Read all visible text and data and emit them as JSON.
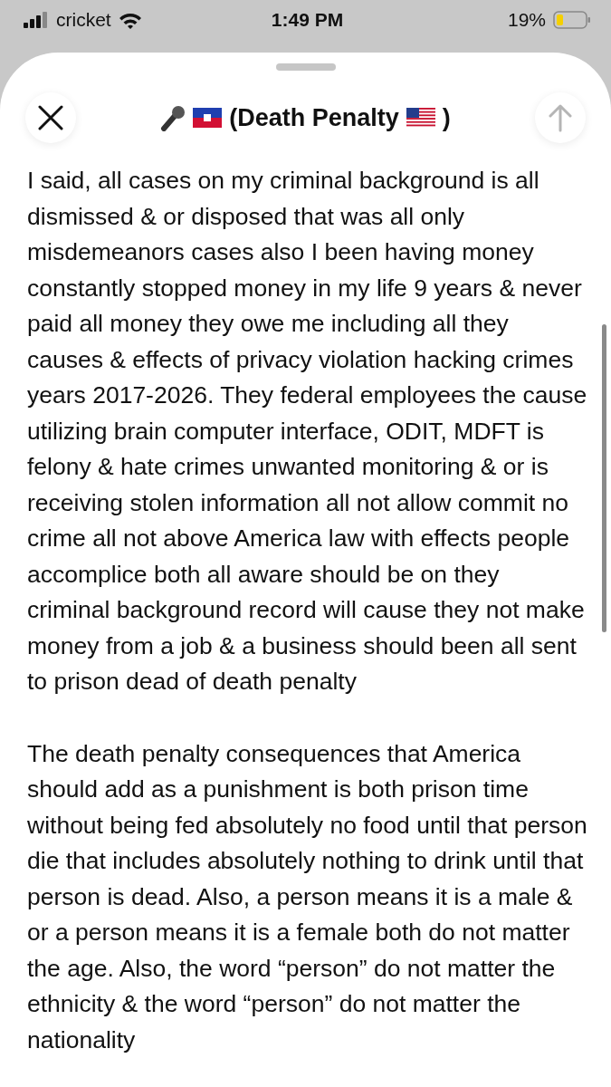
{
  "status_bar": {
    "carrier": "cricket",
    "time": "1:49 PM",
    "battery": "19%"
  },
  "sheet": {
    "title_parts": [
      {
        "kind": "microphone"
      },
      {
        "kind": "flag_haiti"
      },
      {
        "kind": "text",
        "text": "(Death Penalty"
      },
      {
        "kind": "flag_us"
      },
      {
        "kind": "text",
        "text": ")"
      }
    ],
    "send_disabled": true
  },
  "body": {
    "paragraphs": [
      "I said, all cases on my criminal background is all dismissed & or disposed that was all only misdemeanors cases also I been having money constantly stopped money in my life 9 years & never paid all money they owe me including all they causes & effects of privacy violation hacking crimes years 2017-2026. They federal employees the cause utilizing brain computer interface, ODIT, MDFT is felony & hate crimes unwanted monitoring & or is receiving stolen information all not allow commit no crime all not above America law with effects people accomplice both all aware should be on they criminal background record will cause they not make money from a job & a business should been all sent to prison dead of death penalty",
      "The death penalty consequences that America should add as a punishment is both prison time without being fed absolutely no food until that person die that includes absolutely nothing to drink until that person is dead. Also, a person means it is a male & or a person means it is a female both do not matter the age. Also, the word “person” do not matter the ethnicity & the word “person” do not matter the nationality"
    ]
  }
}
